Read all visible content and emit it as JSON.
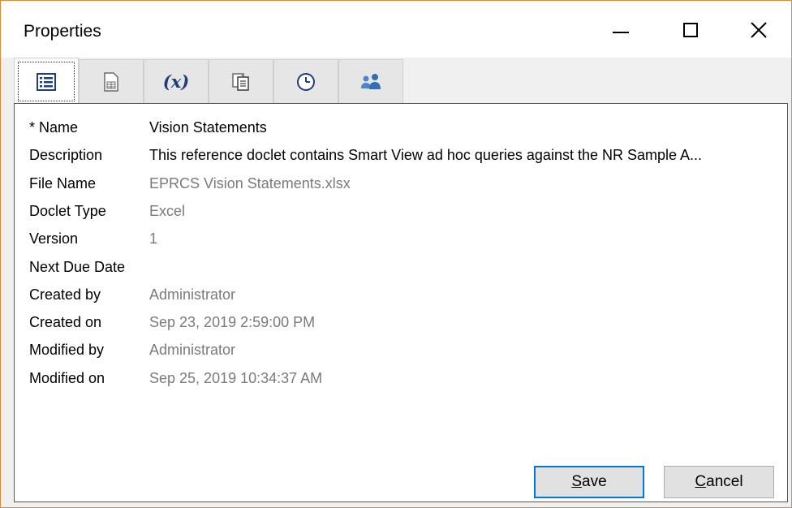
{
  "window": {
    "title": "Properties"
  },
  "tabs": [
    {
      "icon": "list-properties-icon",
      "active": true
    },
    {
      "icon": "document-icon",
      "active": false
    },
    {
      "icon": "variable-icon",
      "label": "(x)",
      "active": false
    },
    {
      "icon": "document-copy-icon",
      "active": false
    },
    {
      "icon": "clock-icon",
      "active": false
    },
    {
      "icon": "users-icon",
      "active": false
    }
  ],
  "properties": [
    {
      "label": "* Name",
      "value": "Vision Statements",
      "dark": true
    },
    {
      "label": "Description",
      "value": "This reference doclet contains Smart View ad hoc queries against the NR Sample A...",
      "dark": true
    },
    {
      "label": "File Name",
      "value": "EPRCS Vision Statements.xlsx"
    },
    {
      "label": "Doclet Type",
      "value": "Excel"
    },
    {
      "label": "Version",
      "value": "1"
    },
    {
      "label": "Next Due Date",
      "value": ""
    },
    {
      "label": "Created by",
      "value": "Administrator"
    },
    {
      "label": "Created on",
      "value": "Sep 23, 2019 2:59:00 PM"
    },
    {
      "label": "Modified by",
      "value": "Administrator"
    },
    {
      "label": "Modified on",
      "value": "Sep 25, 2019 10:34:37 AM"
    }
  ],
  "buttons": {
    "save": {
      "mnemonic": "S",
      "rest": "ave"
    },
    "cancel": {
      "mnemonic": "C",
      "rest": "ancel"
    }
  },
  "colors": {
    "border": "#e08a3c",
    "focus_blue": "#0078d7",
    "value_grey": "#7a7a7a"
  }
}
